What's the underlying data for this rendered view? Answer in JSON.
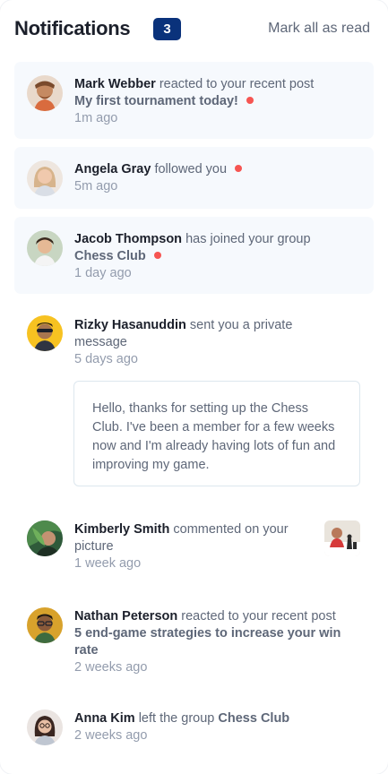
{
  "header": {
    "title": "Notifications",
    "unread_count": "3",
    "mark_all_label": "Mark all as read"
  },
  "notifications": [
    {
      "name": "Mark Webber",
      "action": "reacted to your recent post",
      "target": "My first tournament today!",
      "time": "1m ago",
      "unread": true,
      "avatar_icon": "avatar-mark-webber"
    },
    {
      "name": "Angela Gray",
      "action": "followed you",
      "time": "5m ago",
      "unread": true,
      "avatar_icon": "avatar-angela-gray"
    },
    {
      "name": "Jacob Thompson",
      "action": "has joined your group",
      "target": "Chess Club",
      "time": "1 day ago",
      "unread": true,
      "avatar_icon": "avatar-jacob-thompson"
    },
    {
      "name": "Rizky Hasanuddin",
      "action": "sent you a private message",
      "time": "5 days ago",
      "unread": false,
      "message": "Hello, thanks for setting up the Chess Club. I've been a member for a few weeks now and I'm already having lots of fun and improving my game.",
      "avatar_icon": "avatar-rizky-hasanuddin"
    },
    {
      "name": "Kimberly Smith",
      "action": "commented on your picture",
      "time": "1 week ago",
      "unread": false,
      "avatar_icon": "avatar-kimberly-smith",
      "thumbnail_icon": "chess-picture-thumbnail"
    },
    {
      "name": "Nathan Peterson",
      "action": "reacted to your recent post",
      "target": "5 end-game strategies to increase your win rate",
      "time": "2 weeks ago",
      "unread": false,
      "avatar_icon": "avatar-nathan-peterson"
    },
    {
      "name": "Anna Kim",
      "action": "left the group",
      "target": "Chess Club",
      "time": "2 weeks ago",
      "unread": false,
      "avatar_icon": "avatar-anna-kim"
    }
  ],
  "colors": {
    "badge_bg": "#0a327b",
    "unread_bg": "#f6f9fd",
    "unread_dot": "#f65552",
    "name_text": "#1c202b",
    "body_text": "#5e6778",
    "time_text": "#939cad"
  }
}
